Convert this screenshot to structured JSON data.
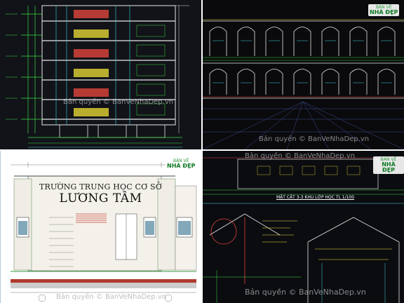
{
  "watermark": "Bản quyền © BanVeNhaDep.vn",
  "logo": {
    "line1": "BẢN VẼ",
    "line2": "NHÀ ĐẸP"
  },
  "school": {
    "line1": "TRƯỜNG TRUNG HỌC CƠ SỞ",
    "line2": "LƯƠNG TÂM"
  },
  "section_title": "MẶT CẮT 3-3 KHU LỚP HỌC TL 1/100",
  "colors": {
    "cad_bg": "#111318",
    "cad_green": "#3ddc45",
    "cad_yellow": "#f2e237",
    "cad_red": "#e0463c",
    "cad_cyan": "#3fd6e0",
    "cad_white": "#e8e8e8"
  }
}
